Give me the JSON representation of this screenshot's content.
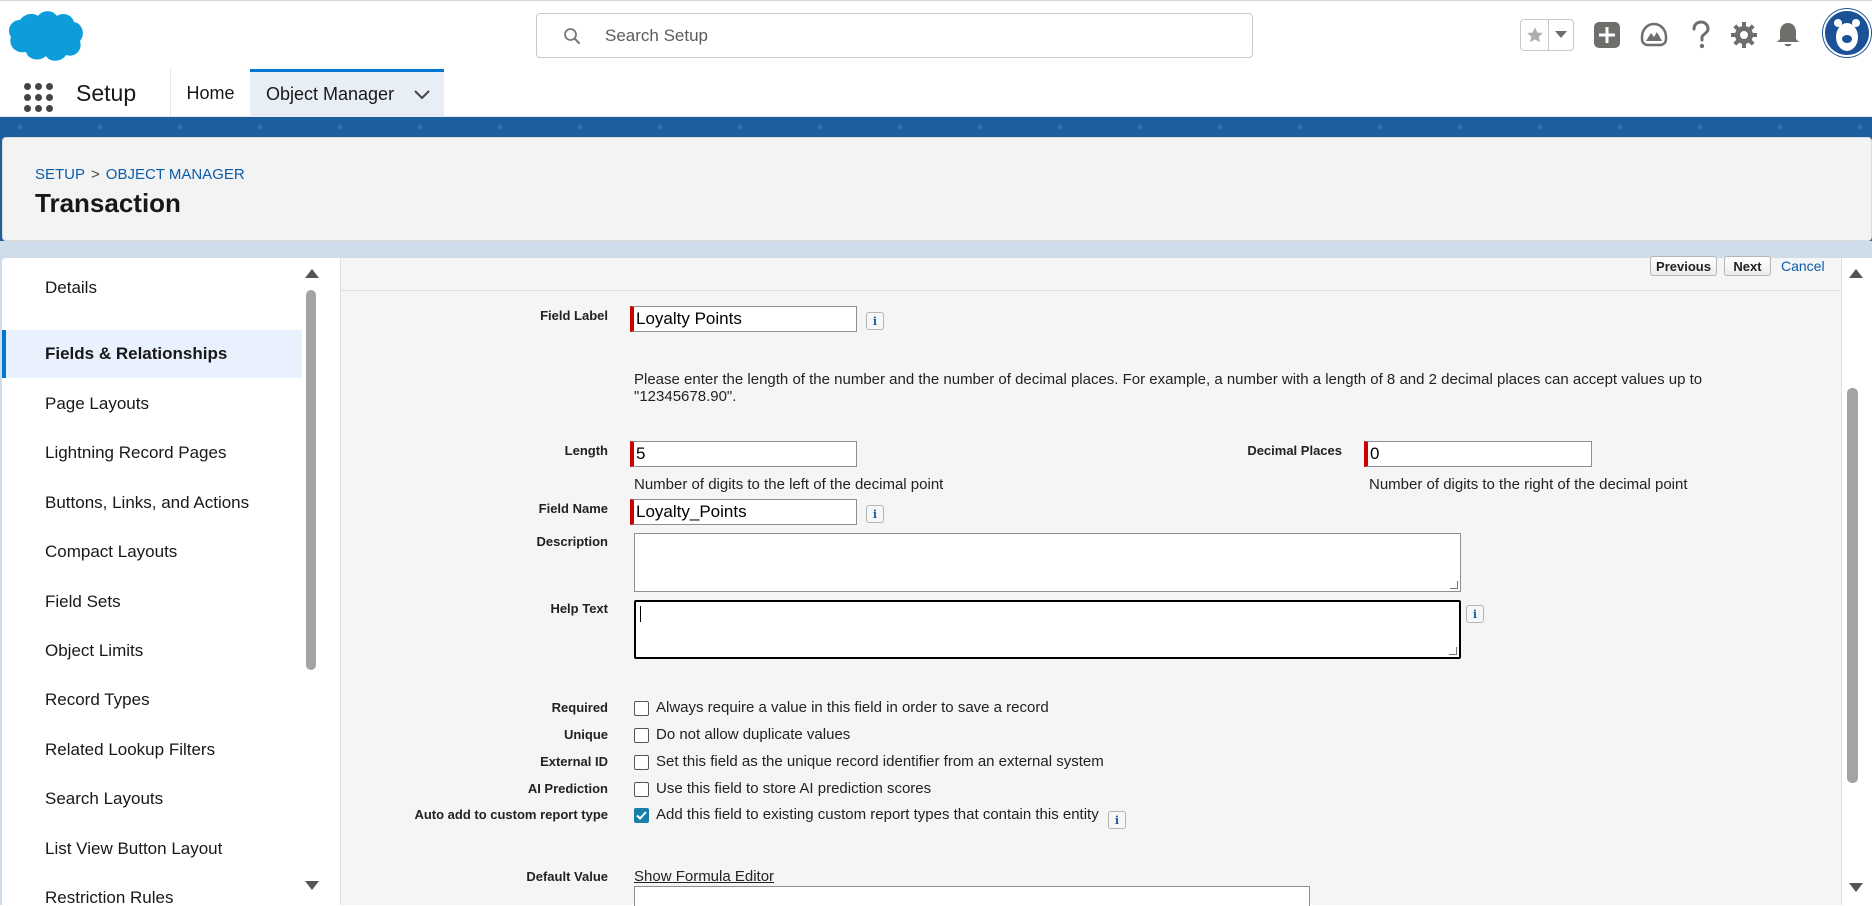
{
  "header": {
    "search_placeholder": "Search Setup"
  },
  "context_nav": {
    "app_name": "Setup",
    "tabs": [
      {
        "label": "Home"
      },
      {
        "label": "Object Manager"
      }
    ]
  },
  "page_header": {
    "breadcrumb": [
      "SETUP",
      "OBJECT MANAGER"
    ],
    "breadcrumb_separator": ">",
    "title": "Transaction"
  },
  "sidebar": {
    "items": [
      {
        "label": "Details"
      },
      {
        "label": "Fields & Relationships"
      },
      {
        "label": "Page Layouts"
      },
      {
        "label": "Lightning Record Pages"
      },
      {
        "label": "Buttons, Links, and Actions"
      },
      {
        "label": "Compact Layouts"
      },
      {
        "label": "Field Sets"
      },
      {
        "label": "Object Limits"
      },
      {
        "label": "Record Types"
      },
      {
        "label": "Related Lookup Filters"
      },
      {
        "label": "Search Layouts"
      },
      {
        "label": "List View Button Layout"
      },
      {
        "label": "Restriction Rules"
      }
    ],
    "active_index": 1
  },
  "form": {
    "buttons": {
      "previous": "Previous",
      "next": "Next",
      "cancel": "Cancel"
    },
    "field_label": {
      "label": "Field Label",
      "value": "Loyalty Points"
    },
    "instructions": "Please enter the length of the number and the number of decimal places. For example, a number with a length of 8 and 2 decimal places can accept values up to \"12345678.90\".",
    "length": {
      "label": "Length",
      "value": "5",
      "hint": "Number of digits to the left of the decimal point"
    },
    "decimal_places": {
      "label": "Decimal Places",
      "value": "0",
      "hint": "Number of digits to the right of the decimal point"
    },
    "field_name": {
      "label": "Field Name",
      "value": "Loyalty_Points"
    },
    "description": {
      "label": "Description",
      "value": ""
    },
    "help_text": {
      "label": "Help Text",
      "value": ""
    },
    "options": [
      {
        "label": "Required",
        "text": "Always require a value in this field in order to save a record",
        "checked": false
      },
      {
        "label": "Unique",
        "text": "Do not allow duplicate values",
        "checked": false
      },
      {
        "label": "External ID",
        "text": "Set this field as the unique record identifier from an external system",
        "checked": false
      },
      {
        "label": "AI Prediction",
        "text": "Use this field to store AI prediction scores",
        "checked": false
      },
      {
        "label": "Auto add to custom report type",
        "text": "Add this field to existing custom report types that contain this entity",
        "checked": true
      }
    ],
    "default_value": {
      "label": "Default Value",
      "link": "Show Formula Editor"
    },
    "info_glyph": "i"
  },
  "colors": {
    "brand_blue": "#0176d3",
    "required_bar": "#cc0000",
    "band_blue": "#1b5f9e",
    "checkbox_checked": "#1a7fa8"
  }
}
